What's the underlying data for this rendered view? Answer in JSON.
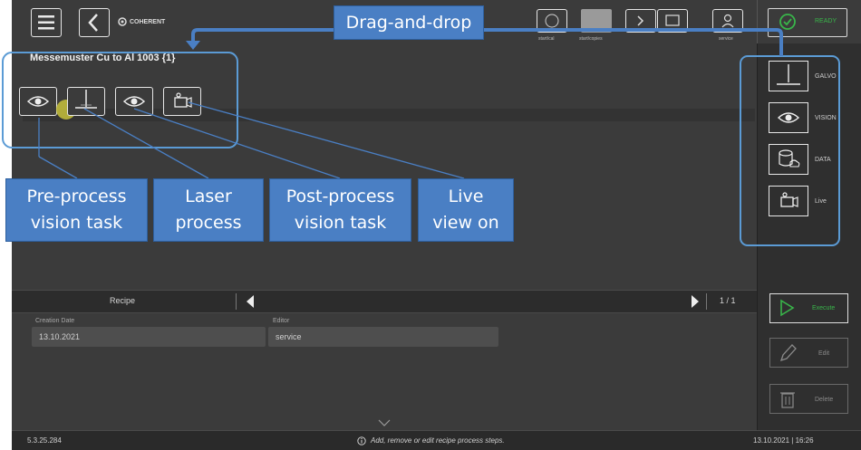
{
  "header": {
    "logo_text": "COHERENT",
    "ready_label": "READY",
    "top_labels": [
      "start/cal",
      "start/copies",
      "",
      "",
      "service"
    ]
  },
  "recipe": {
    "title": "Messemuster Cu to Al 1003 {1}"
  },
  "right_panel": {
    "items": [
      {
        "label": "GALVO",
        "icon": "laser-icon"
      },
      {
        "label": "VISION",
        "icon": "eye-icon"
      },
      {
        "label": "DATA",
        "icon": "database-icon"
      },
      {
        "label": "Live",
        "icon": "camera-icon"
      }
    ],
    "execute_label": "Execute",
    "edit_label": "Edit",
    "delete_label": "Delete"
  },
  "recipe_bar": {
    "label": "Recipe",
    "page": "1 / 1"
  },
  "form": {
    "creation_label": "Creation Date",
    "creation_value": "13.10.2021",
    "editor_label": "Editor",
    "editor_value": "service"
  },
  "status_bar": {
    "version": "5.3.25.284",
    "hint": "Add, remove or edit recipe process steps.",
    "datetime": "13.10.2021 | 16:26"
  },
  "callouts": {
    "drag_drop": "Drag-and-drop",
    "pre_process": "Pre-process\nvision task",
    "laser": "Laser\nprocess",
    "post_process": "Post-process\nvision task",
    "live_view": "Live\nview on"
  },
  "colors": {
    "background": "#3b3b3b",
    "panel": "#2f2f2f",
    "accent_green": "#39b54a",
    "callout_blue": "#4a7fc4",
    "outline_blue": "#5b9bd5"
  }
}
